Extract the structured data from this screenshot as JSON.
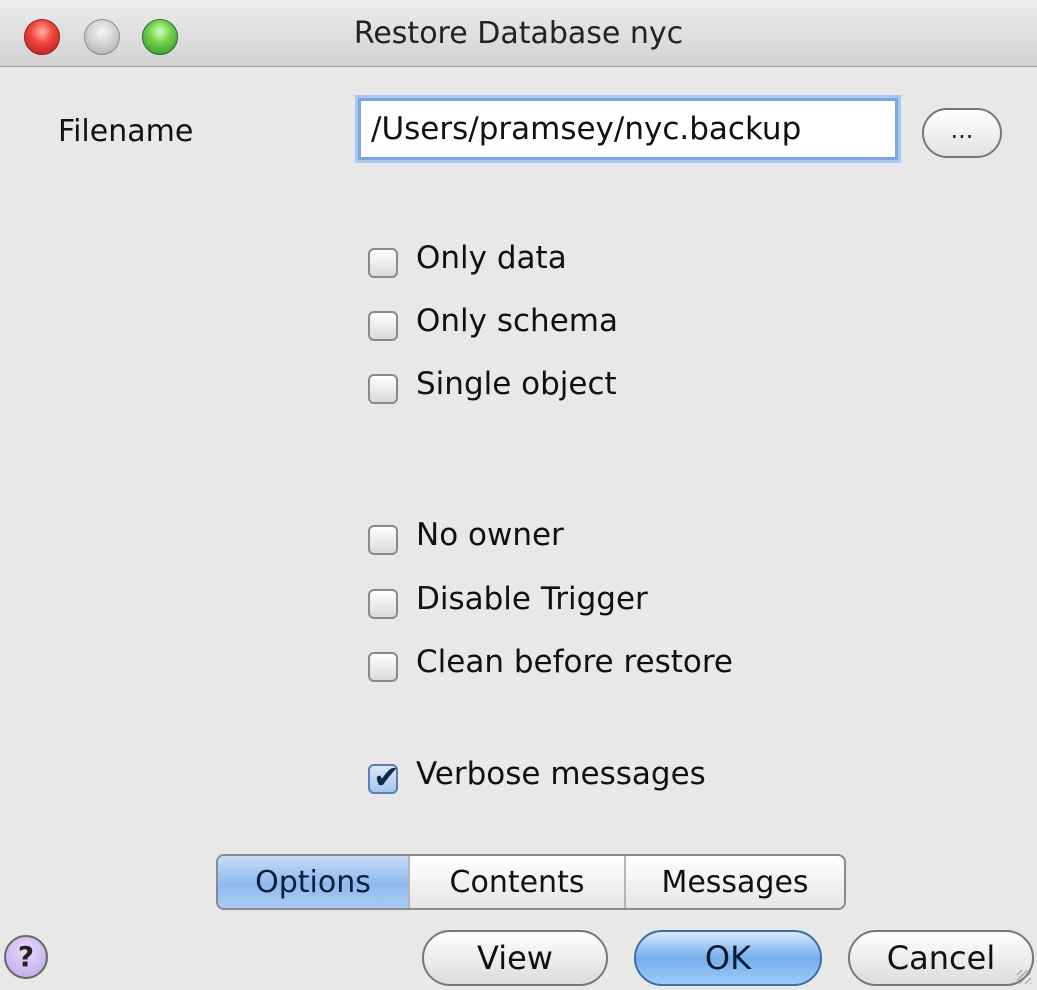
{
  "window": {
    "title": "Restore Database nyc"
  },
  "filename": {
    "label": "Filename",
    "value": "/Users/pramsey/nyc.backup",
    "browse_label": "..."
  },
  "options_group1": [
    {
      "label": "Only data",
      "checked": false
    },
    {
      "label": "Only schema",
      "checked": false
    },
    {
      "label": "Single object",
      "checked": false
    }
  ],
  "options_group2": [
    {
      "label": "No owner",
      "checked": false
    },
    {
      "label": "Disable Trigger",
      "checked": false
    },
    {
      "label": "Clean before restore",
      "checked": false
    }
  ],
  "verbose": {
    "label": "Verbose messages",
    "checked": true
  },
  "tabs": [
    {
      "label": "Options",
      "active": true
    },
    {
      "label": "Contents",
      "active": false
    },
    {
      "label": "Messages",
      "active": false
    }
  ],
  "buttons": {
    "help": "?",
    "view": "View",
    "ok": "OK",
    "cancel": "Cancel"
  },
  "colors": {
    "accent_blue": "#8fb9ee",
    "focus_ring": "#7aa7e0"
  }
}
